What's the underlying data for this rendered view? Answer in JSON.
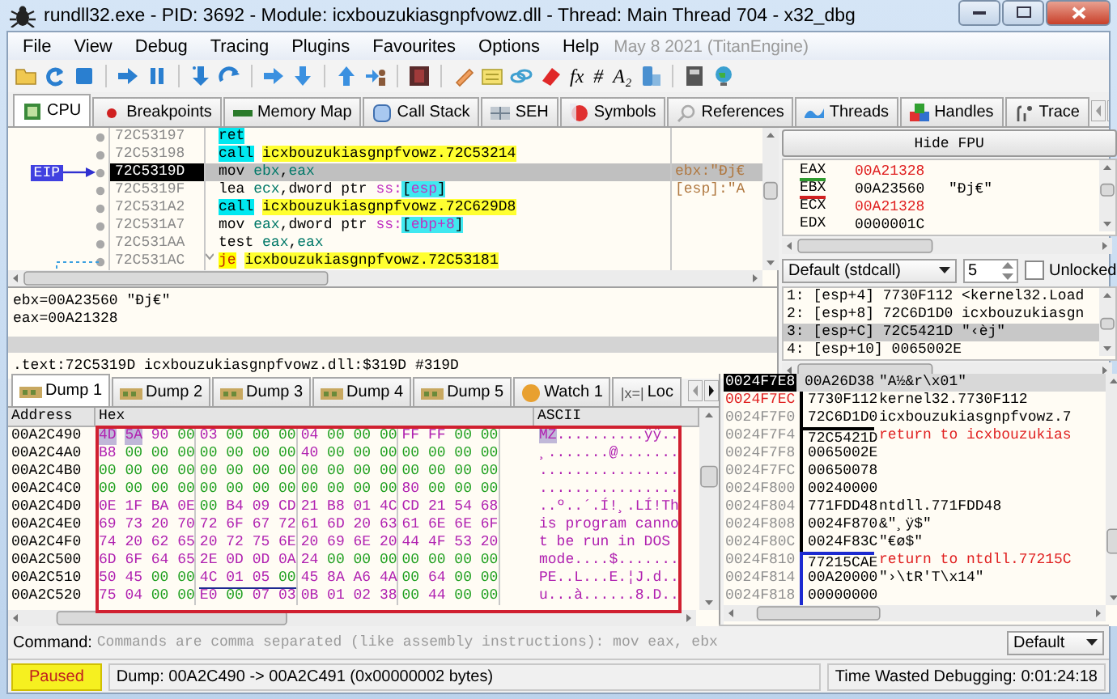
{
  "window": {
    "title": "rundll32.exe - PID: 3692 - Module: icxbouzukiasgnpfvowz.dll - Thread: Main Thread 704 - x32_dbg"
  },
  "menu": [
    "File",
    "View",
    "Debug",
    "Tracing",
    "Plugins",
    "Favourites",
    "Options",
    "Help"
  ],
  "build_info": "May 8 2021 (TitanEngine)",
  "toolbar": [
    {
      "kind": "icon"
    },
    {
      "kind": "icon"
    },
    {
      "kind": "icon"
    },
    {
      "kind": "separator"
    },
    {
      "kind": "icon"
    },
    {
      "kind": "icon"
    },
    {
      "kind": "separator"
    },
    {
      "kind": "icon"
    },
    {
      "kind": "icon"
    },
    {
      "kind": "separator"
    },
    {
      "kind": "icon"
    },
    {
      "kind": "icon"
    },
    {
      "kind": "separator"
    },
    {
      "kind": "icon"
    },
    {
      "kind": "icon"
    },
    {
      "kind": "separator"
    },
    {
      "kind": "icon"
    },
    {
      "kind": "separator"
    },
    {
      "kind": "icon"
    },
    {
      "kind": "icon"
    },
    {
      "kind": "icon"
    },
    {
      "kind": "icon"
    },
    {
      "kind": "glyph",
      "text": "fx"
    },
    {
      "kind": "glyph",
      "text": "#"
    },
    {
      "kind": "glyph",
      "text": "A₂"
    },
    {
      "kind": "icon"
    },
    {
      "kind": "separator"
    },
    {
      "kind": "icon"
    },
    {
      "kind": "icon"
    }
  ],
  "tabs": [
    {
      "label": "CPU",
      "selected": true
    },
    {
      "label": "Breakpoints",
      "selected": false
    },
    {
      "label": "Memory Map",
      "selected": false
    },
    {
      "label": "Call Stack",
      "selected": false
    },
    {
      "label": "SEH",
      "selected": false
    },
    {
      "label": "Symbols",
      "selected": false
    },
    {
      "label": "References",
      "selected": false
    },
    {
      "label": "Threads",
      "selected": false
    },
    {
      "label": "Handles",
      "selected": false
    },
    {
      "label": "Trace",
      "selected": false
    }
  ],
  "disassembly": {
    "eip_label": "EIP",
    "rows": [
      {
        "address": "72C53197",
        "selected": false,
        "eip": false,
        "mnemonic": {
          "text": "ret",
          "kind": "ret"
        },
        "operands": []
      },
      {
        "address": "72C53198",
        "selected": false,
        "eip": false,
        "mnemonic": {
          "text": "call",
          "kind": "call"
        },
        "operands": [
          {
            "text": "icxbouzukiasgnpfvowz.72C53214",
            "kind": "label"
          }
        ]
      },
      {
        "address": "72C5319D",
        "selected": true,
        "eip": true,
        "mnemonic": {
          "text": "mov",
          "kind": "plain"
        },
        "operands": [
          {
            "text": "ebx",
            "kind": "reg"
          },
          {
            "text": ",",
            "kind": "plain"
          },
          {
            "text": "eax",
            "kind": "reg"
          }
        ],
        "comment": "ebx:\"Đj€"
      },
      {
        "address": "72C5319F",
        "selected": false,
        "eip": false,
        "mnemonic": {
          "text": "lea",
          "kind": "plain"
        },
        "operands": [
          {
            "text": "ecx",
            "kind": "reg"
          },
          {
            "text": ",dword ptr ",
            "kind": "plain"
          },
          {
            "text": "ss:",
            "kind": "seg"
          },
          {
            "text": "[",
            "kind": "bracket"
          },
          {
            "text": "esp",
            "kind": "mem"
          },
          {
            "text": "]",
            "kind": "bracket"
          }
        ],
        "comment": "[esp]:\"A"
      },
      {
        "address": "72C531A2",
        "selected": false,
        "eip": false,
        "mnemonic": {
          "text": "call",
          "kind": "call"
        },
        "operands": [
          {
            "text": "icxbouzukiasgnpfvowz.72C629D8",
            "kind": "label"
          }
        ]
      },
      {
        "address": "72C531A7",
        "selected": false,
        "eip": false,
        "mnemonic": {
          "text": "mov",
          "kind": "plain"
        },
        "operands": [
          {
            "text": "eax",
            "kind": "reg"
          },
          {
            "text": ",dword ptr ",
            "kind": "plain"
          },
          {
            "text": "ss:",
            "kind": "seg"
          },
          {
            "text": "[",
            "kind": "bracket"
          },
          {
            "text": "ebp+8",
            "kind": "mem"
          },
          {
            "text": "]",
            "kind": "bracket"
          }
        ]
      },
      {
        "address": "72C531AA",
        "selected": false,
        "eip": false,
        "mnemonic": {
          "text": "test",
          "kind": "plain"
        },
        "operands": [
          {
            "text": "eax",
            "kind": "reg"
          },
          {
            "text": ",",
            "kind": "plain"
          },
          {
            "text": "eax",
            "kind": "reg"
          }
        ]
      },
      {
        "address": "72C531AC",
        "selected": false,
        "eip": false,
        "mnemonic": {
          "text": "je",
          "kind": "jump"
        },
        "operands": [
          {
            "text": "icxbouzukiasgnpfvowz.72C53181",
            "kind": "label"
          }
        ]
      }
    ]
  },
  "info": {
    "lines": [
      "ebx=00A23560 \"Đj€\"",
      "eax=00A21328"
    ],
    "location": ".text:72C5319D icxbouzukiasgnpfvowz.dll:$319D #319D"
  },
  "fpu_button": "Hide FPU",
  "registers": [
    {
      "name": "EAX",
      "value": "00A21328",
      "changed": true,
      "color": "#2e9b2e"
    },
    {
      "name": "EBX",
      "value": "00A23560",
      "changed": false,
      "color": "#d02020",
      "comment": "\"Đj€\""
    },
    {
      "name": "ECX",
      "value": "00A21328",
      "changed": true
    },
    {
      "name": "EDX",
      "value": "0000001C",
      "changed": false
    }
  ],
  "call_convention": {
    "value": "Default (stdcall)",
    "arg_count": "5",
    "unlocked": {
      "label": "Unlocked",
      "checked": false
    }
  },
  "arguments": [
    {
      "text": "1: [esp+4] 7730F112 <kernel32.Load",
      "selected": false
    },
    {
      "text": "2: [esp+8] 72C6D1D0 icxbouzukiasgn",
      "selected": false
    },
    {
      "text": "3: [esp+C] 72C5421D \"‹èj\"",
      "selected": true
    },
    {
      "text": "4: [esp+10] 0065002E",
      "selected": false
    }
  ],
  "dump_tabs": [
    {
      "label": "Dump 1",
      "selected": true
    },
    {
      "label": "Dump 2",
      "selected": false
    },
    {
      "label": "Dump 3",
      "selected": false
    },
    {
      "label": "Dump 4",
      "selected": false
    },
    {
      "label": "Dump 5",
      "selected": false
    },
    {
      "label": "Watch 1",
      "selected": false
    },
    {
      "label": "Loc",
      "icon_text": "|x=|",
      "selected": false
    }
  ],
  "dump": {
    "columns": [
      "Address",
      "Hex",
      "ASCII"
    ],
    "rows": [
      {
        "address": "00A2C490",
        "hex": [
          {
            "text": "4D 5A",
            "kind": "selected"
          },
          {
            "text": "90 00 03 00 00 00 04 00 00 00 FF FF 00 00",
            "kind": "plain"
          }
        ],
        "ascii": [
          {
            "text": "MZ",
            "kind": "selected"
          },
          {
            "text": "..........ÿÿ..",
            "kind": "plain"
          }
        ]
      },
      {
        "address": "00A2C4A0",
        "hex": [
          {
            "text": "B8 00 00 00 00 00 00 00 40 00 00 00 00 00 00 00",
            "kind": "plain"
          }
        ],
        "ascii": [
          {
            "text": "¸.......@.......",
            "kind": "plain"
          }
        ]
      },
      {
        "address": "00A2C4B0",
        "hex": [
          {
            "text": "00 00 00 00 00 00 00 00 00 00 00 00 00 00 00 00",
            "kind": "plain"
          }
        ],
        "ascii": [
          {
            "text": "................",
            "kind": "plain"
          }
        ]
      },
      {
        "address": "00A2C4C0",
        "hex": [
          {
            "text": "00 00 00 00 00 00 00 00 00 00 00 00 80 00 00 00",
            "kind": "plain"
          }
        ],
        "ascii": [
          {
            "text": "................",
            "kind": "plain"
          }
        ]
      },
      {
        "address": "00A2C4D0",
        "hex": [
          {
            "text": "0E 1F BA 0E 00 B4 09 CD 21 B8 01 4C CD 21 54 68",
            "kind": "plain"
          }
        ],
        "ascii": [
          {
            "text": "..º..´.Í!¸.LÍ!Th",
            "kind": "plain"
          }
        ]
      },
      {
        "address": "00A2C4E0",
        "hex": [
          {
            "text": "69 73 20 70 72 6F 67 72 61 6D 20 63 61 6E 6E 6F",
            "kind": "plain"
          }
        ],
        "ascii": [
          {
            "text": "is program canno",
            "kind": "plain"
          }
        ]
      },
      {
        "address": "00A2C4F0",
        "hex": [
          {
            "text": "74 20 62 65 20 72 75 6E 20 69 6E 20 44 4F 53 20",
            "kind": "plain"
          }
        ],
        "ascii": [
          {
            "text": "t be run in DOS ",
            "kind": "plain"
          }
        ]
      },
      {
        "address": "00A2C500",
        "hex": [
          {
            "text": "6D 6F 64 65 2E 0D 0D 0A 24 00 00 00 00 00 00 00",
            "kind": "plain"
          }
        ],
        "ascii": [
          {
            "text": "mode....$.......",
            "kind": "plain"
          }
        ]
      },
      {
        "address": "00A2C510",
        "hex": [
          {
            "text": "50 45 00 00",
            "kind": "plain"
          },
          {
            "text": "4C 01 05 00",
            "kind": "underlined"
          },
          {
            "text": "45 8A A6 4A 00 64 00 00",
            "kind": "plain"
          }
        ],
        "ascii": [
          {
            "text": "PE..L...E.¦J.d..",
            "kind": "plain"
          }
        ]
      },
      {
        "address": "00A2C520",
        "hex": [
          {
            "text": "75 04 00 00 E0 00 07 03 0B 01 02 38 00 44 00 00",
            "kind": "plain"
          }
        ],
        "ascii": [
          {
            "text": "u...à......8.D..",
            "kind": "plain"
          }
        ]
      }
    ]
  },
  "stack": [
    {
      "address": "0024F7E8",
      "value": "00A26D38",
      "comment": {
        "text": "\"A½&r\\x01\"",
        "kind": "plain"
      },
      "selected": true,
      "highlighted": false,
      "frame_top": false,
      "frame_bottom": false
    },
    {
      "address": "0024F7EC",
      "value": "7730F112",
      "comment": {
        "text": "kernel32.7730F112",
        "kind": "plain"
      },
      "selected": false,
      "highlighted": true,
      "frame_top": false,
      "frame_bottom": false,
      "color": "#000000"
    },
    {
      "address": "0024F7F0",
      "value": "72C6D1D0",
      "comment": {
        "text": "icxbouzukiasgnpfvowz.7",
        "kind": "plain"
      },
      "selected": false,
      "highlighted": false,
      "frame_top": false,
      "frame_bottom": true,
      "color": "#000000"
    },
    {
      "address": "0024F7F4",
      "value": "72C5421D",
      "comment": {
        "text": "return to icxbouzukias",
        "kind": "return"
      },
      "selected": false,
      "highlighted": false,
      "frame_top": true,
      "frame_bottom": false,
      "color": "#000000"
    },
    {
      "address": "0024F7F8",
      "value": "0065002E",
      "selected": false,
      "highlighted": false,
      "frame_top": false,
      "frame_bottom": false,
      "color": "#000000"
    },
    {
      "address": "0024F7FC",
      "value": "00650078",
      "selected": false,
      "highlighted": false,
      "frame_top": false,
      "frame_bottom": false,
      "color": "#000000"
    },
    {
      "address": "0024F800",
      "value": "00240000",
      "selected": false,
      "highlighted": false,
      "frame_top": false,
      "frame_bottom": false,
      "color": "#000000"
    },
    {
      "address": "0024F804",
      "value": "771FDD48",
      "comment": {
        "text": "ntdll.771FDD48",
        "kind": "plain"
      },
      "selected": false,
      "highlighted": false,
      "frame_top": false,
      "frame_bottom": false,
      "color": "#000000"
    },
    {
      "address": "0024F808",
      "value": "0024F870",
      "comment": {
        "text": "&\"¸ÿ$\"",
        "kind": "plain"
      },
      "selected": false,
      "highlighted": false,
      "frame_top": false,
      "frame_bottom": false,
      "color": "#000000"
    },
    {
      "address": "0024F80C",
      "value": "0024F83C",
      "comment": {
        "text": "\"€ø$\"",
        "kind": "plain"
      },
      "selected": false,
      "highlighted": false,
      "frame_top": false,
      "frame_bottom": true,
      "color": "#000000"
    },
    {
      "address": "0024F810",
      "value": "77215CAE",
      "comment": {
        "text": "return to ntdll.77215C",
        "kind": "return"
      },
      "selected": false,
      "highlighted": false,
      "frame_top": true,
      "frame_bottom": false,
      "color": "#1c2ad0"
    },
    {
      "address": "0024F814",
      "value": "00A20000",
      "comment": {
        "text": "\"›\\tR'T\\x14\"",
        "kind": "plain"
      },
      "selected": false,
      "highlighted": false,
      "frame_top": false,
      "frame_bottom": false,
      "color": "#1c2ad0"
    },
    {
      "address": "0024F818",
      "value": "00000000",
      "selected": false,
      "highlighted": false,
      "frame_top": false,
      "frame_bottom": false,
      "color": "#1c2ad0"
    }
  ],
  "command": {
    "label": "Command:",
    "placeholder": "Commands are comma separated (like assembly instructions): mov eax, ebx",
    "mode": "Default"
  },
  "status": {
    "state": "Paused",
    "message": "Dump: 00A2C490 -> 00A2C491 (0x00000002 bytes)",
    "timer": "Time Wasted Debugging: 0:01:24:18"
  }
}
